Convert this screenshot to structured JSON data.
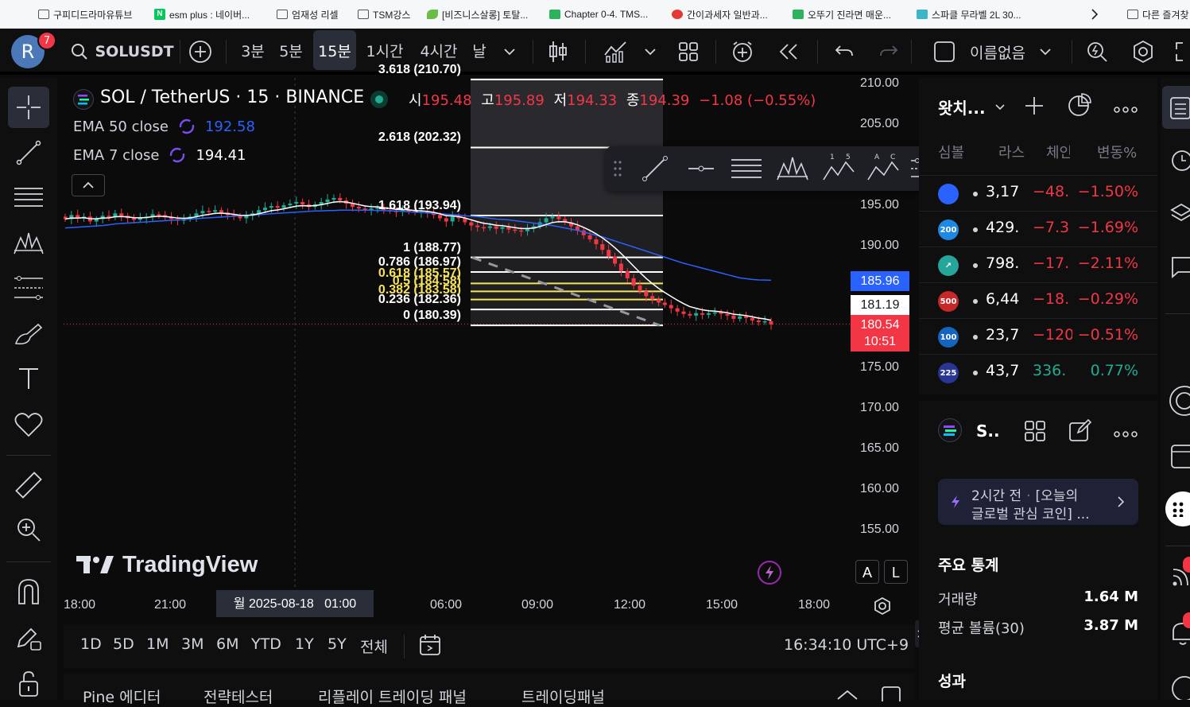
{
  "bookmarks": [
    "구피디드라마유튜브",
    "esm plus : 네이버...",
    "엄재성 리셀",
    "TSM강스",
    "[비즈니스살롱] 토탈...",
    "Chapter 0-4. TMS...",
    "간이과세자 일반과...",
    "오뚜기 진라면 매운...",
    "스파클 무라벨 2L 30...",
    "다른 즐겨찾"
  ],
  "toolbar": {
    "avatar_letter": "R",
    "notif_count": "7",
    "symbol": "SOLUSDT",
    "intervals": [
      "3분",
      "5분",
      "15분",
      "1시간",
      "4시간",
      "날"
    ],
    "active_interval": "15분",
    "layout_name": "이름없음"
  },
  "legend": {
    "title": "SOL / TetherUS · 15 · BINANCE",
    "o_label": "시",
    "o": "195.48",
    "h_label": "고",
    "h": "195.89",
    "l_label": "저",
    "l": "194.33",
    "c_label": "종",
    "c": "194.39",
    "change": "−1.08 (−0.55%)",
    "ema50_label": "EMA 50 close",
    "ema50": "192.58",
    "ema7_label": "EMA 7 close",
    "ema7": "194.41"
  },
  "fib_levels": [
    {
      "label": "3.618 (210.70)",
      "price": 210.7,
      "color": "#ffffff"
    },
    {
      "label": "2.618 (202.32)",
      "price": 202.32,
      "color": "#ffffff"
    },
    {
      "label": "1.618 (193.94)",
      "price": 193.94,
      "color": "#ffffff"
    },
    {
      "label": "1 (188.77)",
      "price": 188.77,
      "color": "#ffffff"
    },
    {
      "label": "0.786 (186.97)",
      "price": 186.97,
      "color": "#ffffff"
    },
    {
      "label": "0.618 (185.57)",
      "price": 185.57,
      "color": "#f7e35a"
    },
    {
      "label": "0.5 (184.58)",
      "price": 184.58,
      "color": "#f7e35a"
    },
    {
      "label": "0.382 (183.58)",
      "price": 183.58,
      "color": "#f7e35a"
    },
    {
      "label": "0.236 (182.36)",
      "price": 182.36,
      "color": "#ffffff"
    },
    {
      "label": "0 (180.39)",
      "price": 180.39,
      "color": "#ffffff"
    }
  ],
  "price_axis": [
    "210.00",
    "205.00",
    "195.00",
    "190.00",
    "175.00",
    "170.00",
    "165.00",
    "160.00",
    "155.00"
  ],
  "price_tags": {
    "ema50": {
      "value": "185.96",
      "color": "#2962ff"
    },
    "ema7": {
      "value": "181.19",
      "color": "#ffffff"
    },
    "last": {
      "value": "180.54",
      "countdown": "10:51",
      "color": "#f23645"
    }
  },
  "time_axis": [
    "18:00",
    "21:00",
    "06:00",
    "09:00",
    "12:00",
    "15:00",
    "18:00"
  ],
  "time_cursor": "월 2025-08-18   01:00",
  "brand": "TradingView",
  "scale_buttons": [
    "A",
    "L"
  ],
  "ranges": [
    "1D",
    "5D",
    "1M",
    "3M",
    "6M",
    "YTD",
    "1Y",
    "5Y",
    "전체"
  ],
  "clock": "16:34:10 UTC+9",
  "bottom_panels": [
    "Pine 에디터",
    "전략테스터",
    "리플레이 트레이딩 패널",
    "트레이딩패널"
  ],
  "watchlist": {
    "title": "왓치...",
    "col_change": "체인",
    "col_pct": "변동%",
    "col_sym": "심볼",
    "col_last": "라스",
    "rows": [
      {
        "icon": "",
        "icon_color": "#2962ff",
        "last": "3,17",
        "chg": "−48.",
        "pct": "−1.50%",
        "dir": "down"
      },
      {
        "icon": "200",
        "icon_color": "#1e88e5",
        "last": "429.",
        "chg": "−7.3",
        "pct": "−1.69%",
        "dir": "down"
      },
      {
        "icon": "↗",
        "icon_color": "#26a69a",
        "last": "798.",
        "chg": "−17.",
        "pct": "−2.11%",
        "dir": "down"
      },
      {
        "icon": "500",
        "icon_color": "#c62828",
        "last": "6,44",
        "chg": "−18.",
        "pct": "−0.29%",
        "dir": "down"
      },
      {
        "icon": "100",
        "icon_color": "#1565c0",
        "last": "23,7",
        "chg": "−120",
        "pct": "−0.51%",
        "dir": "down"
      },
      {
        "icon": "225",
        "icon_color": "#283593",
        "last": "43,7",
        "chg": "336.",
        "pct": "0.77%",
        "dir": "up"
      }
    ]
  },
  "details": {
    "symbol_short": "S..",
    "news_time": "2시간 전",
    "news_text1": "[오늘의",
    "news_text2": "글로벌 관심 코인] ...",
    "stats_title": "주요 통계",
    "volume_label": "거래량",
    "volume": "1.64 M",
    "avg_volume_label": "평균 볼륨(30)",
    "avg_volume": "3.87 M",
    "perf_title": "성과"
  },
  "chart_data": {
    "type": "candlestick",
    "ylim": [
      152,
      211
    ],
    "series": [
      {
        "name": "EMA 50 close",
        "color": "#2962ff"
      },
      {
        "name": "EMA 7 close",
        "color": "#ffffff"
      }
    ],
    "close": [
      193.5,
      194.0,
      193.6,
      193.8,
      193.2,
      193.5,
      193.9,
      193.7,
      194.2,
      193.9,
      193.6,
      193.4,
      193.6,
      193.8,
      194.1,
      194.0,
      193.7,
      193.5,
      193.3,
      193.5,
      193.8,
      194.2,
      194.5,
      194.4,
      194.6,
      194.3,
      194.0,
      193.8,
      193.6,
      193.9,
      194.2,
      194.6,
      194.9,
      195.1,
      194.9,
      195.2,
      195.4,
      195.6,
      195.3,
      195.0,
      195.3,
      195.6,
      195.9,
      196.1,
      195.8,
      195.4,
      195.0,
      194.8,
      194.6,
      194.8,
      194.9,
      194.6,
      194.5,
      194.4,
      194.6,
      194.5,
      194.3,
      194.4,
      194.2,
      194.0,
      193.6,
      193.2,
      193.8,
      193.6,
      193.1,
      192.7,
      192.5,
      192.4,
      192.6,
      192.3,
      192.5,
      192.2,
      192.1,
      192.0,
      192.3,
      192.6,
      193.1,
      193.6,
      193.8,
      193.5,
      193.1,
      192.6,
      192.1,
      191.5,
      191.0,
      190.4,
      189.7,
      188.9,
      188.0,
      187.1,
      186.2,
      185.3,
      184.6,
      184.0,
      183.6,
      183.2,
      182.9,
      182.5,
      182.1,
      181.8,
      181.6,
      181.9,
      181.7,
      181.9,
      182.0,
      181.8,
      181.6,
      181.2,
      181.5,
      181.3,
      181.0,
      180.8,
      180.9,
      180.5
    ],
    "ema50": [
      192.4,
      192.45,
      192.5,
      192.55,
      192.6,
      192.65,
      192.7,
      192.8,
      192.9,
      192.95,
      193.0,
      193.05,
      193.1,
      193.15,
      193.2,
      193.25,
      193.3,
      193.35,
      193.4,
      193.45,
      193.5,
      193.55,
      193.6,
      193.65,
      193.7,
      193.75,
      193.8,
      193.85,
      193.9,
      193.95,
      194.0,
      194.05,
      194.1,
      194.15,
      194.2,
      194.25,
      194.3,
      194.35,
      194.4,
      194.45,
      194.5,
      194.5,
      194.55,
      194.55,
      194.6,
      194.6,
      194.6,
      194.6,
      194.6,
      194.6,
      194.55,
      194.55,
      194.5,
      194.5,
      194.45,
      194.4,
      194.35,
      194.3,
      194.25,
      194.2,
      194.15,
      194.1,
      194.05,
      194.0,
      193.9,
      193.85,
      193.8,
      193.7,
      193.6,
      193.5,
      193.45,
      193.4,
      193.3,
      193.2,
      193.1,
      193.0,
      192.9,
      192.8,
      192.7,
      192.55,
      192.4,
      192.25,
      192.1,
      191.9,
      191.7,
      191.5,
      191.3,
      191.05,
      190.8,
      190.55,
      190.3,
      190.05,
      189.8,
      189.55,
      189.3,
      189.05,
      188.8,
      188.55,
      188.3,
      188.05,
      187.85,
      187.65,
      187.45,
      187.25,
      187.05,
      186.85,
      186.65,
      186.45,
      186.25,
      186.15,
      186.05,
      186.0,
      185.98,
      185.96
    ]
  }
}
